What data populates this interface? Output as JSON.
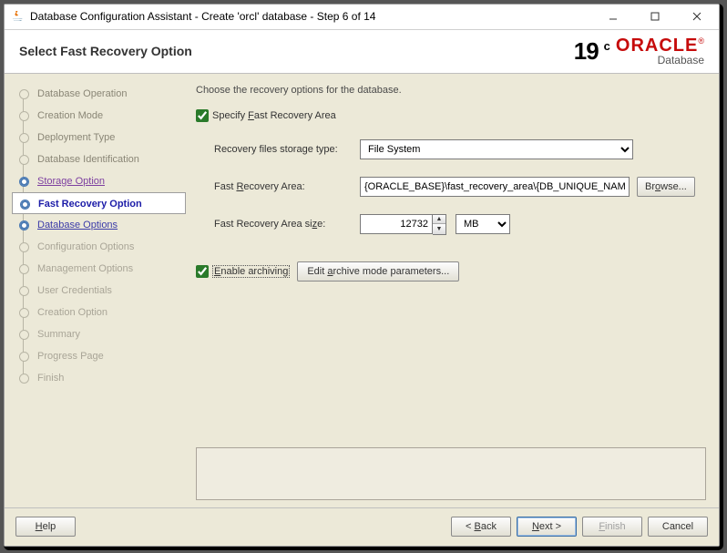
{
  "window": {
    "title": "Database Configuration Assistant - Create 'orcl' database - Step 6 of 14"
  },
  "header": {
    "page_title": "Select Fast Recovery Option",
    "version_major": "19",
    "version_suffix": "c",
    "brand": "ORACLE",
    "brand_sub": "Database"
  },
  "steps": [
    {
      "label": "Database Operation",
      "state": "done"
    },
    {
      "label": "Creation Mode",
      "state": "done"
    },
    {
      "label": "Deployment Type",
      "state": "done"
    },
    {
      "label": "Database Identification",
      "state": "done"
    },
    {
      "label": "Storage Option",
      "state": "visited"
    },
    {
      "label": "Fast Recovery Option",
      "state": "current"
    },
    {
      "label": "Database Options",
      "state": "link"
    },
    {
      "label": "Configuration Options",
      "state": "future"
    },
    {
      "label": "Management Options",
      "state": "future"
    },
    {
      "label": "User Credentials",
      "state": "future"
    },
    {
      "label": "Creation Option",
      "state": "future"
    },
    {
      "label": "Summary",
      "state": "future"
    },
    {
      "label": "Progress Page",
      "state": "future"
    },
    {
      "label": "Finish",
      "state": "future"
    }
  ],
  "main": {
    "instructions": "Choose the recovery options for the database.",
    "specify_fra_checked": true,
    "specify_fra_label_pre": "Specify ",
    "specify_fra_hot": "F",
    "specify_fra_label_post": "ast Recovery Area",
    "storage_type_label": "Recovery files storage type:",
    "storage_type_value": "File System",
    "fra_label_pre": "Fast ",
    "fra_hot": "R",
    "fra_label_post": "ecovery Area:",
    "fra_value": "{ORACLE_BASE}\\fast_recovery_area\\{DB_UNIQUE_NAME}",
    "browse_pre": "Br",
    "browse_hot": "o",
    "browse_post": "wse...",
    "fra_size_label": "Fast Recovery Area si",
    "fra_size_hot": "z",
    "fra_size_post": "e:",
    "fra_size_value": "12732",
    "fra_size_unit": "MB",
    "enable_arch_checked": true,
    "enable_arch_hot": "E",
    "enable_arch_post": "nable archiving",
    "edit_arch_pre": "Edit ",
    "edit_arch_hot": "a",
    "edit_arch_post": "rchive mode parameters..."
  },
  "footer": {
    "help_hot": "H",
    "help_post": "elp",
    "back_pre": "< ",
    "back_hot": "B",
    "back_post": "ack",
    "next_hot": "N",
    "next_post": "ext >",
    "finish_hot": "F",
    "finish_post": "inish",
    "cancel": "Cancel"
  }
}
